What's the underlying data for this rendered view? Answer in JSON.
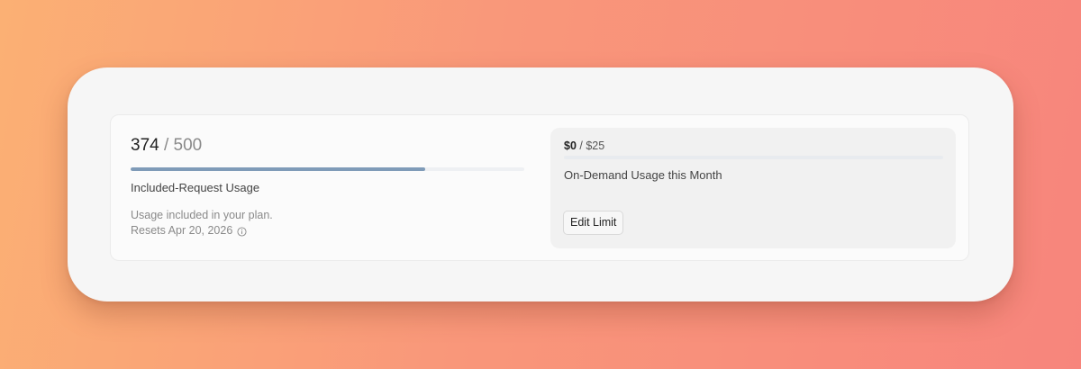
{
  "included": {
    "used": "374",
    "separator": " / ",
    "total": "500",
    "progress_fraction": 0.748,
    "label": "Included-Request Usage",
    "note": "Usage included in your plan.",
    "resets": "Resets Apr 20, 2026",
    "info_icon": "info-circle-icon"
  },
  "on_demand": {
    "spent": "$0",
    "separator": " / ",
    "limit": "$25",
    "progress_fraction": 0,
    "label": "On-Demand Usage this Month",
    "edit_button_label": "Edit Limit"
  },
  "colors": {
    "bar_fill": "#7f9bb8",
    "bar_track": "#eef0f3"
  }
}
